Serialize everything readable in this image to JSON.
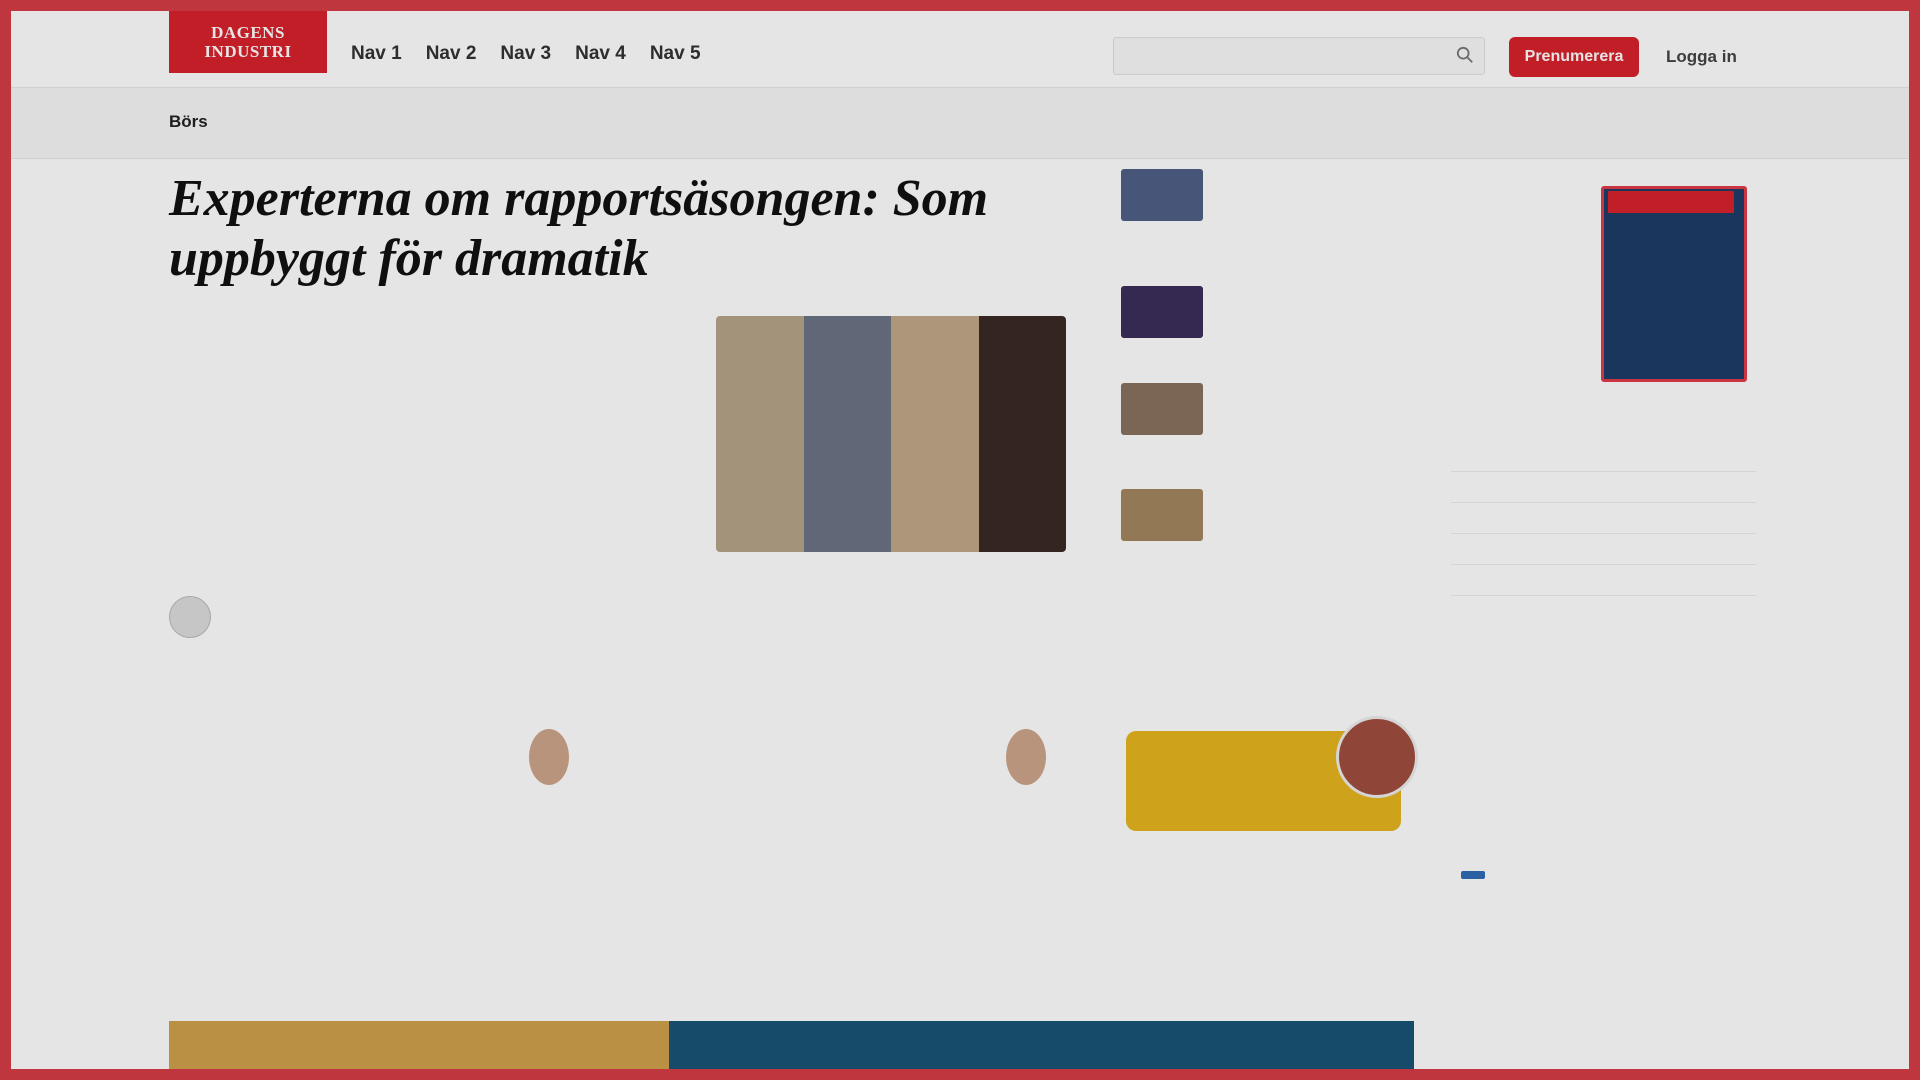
{
  "header": {
    "logo": "DAGENS INDUSTRI",
    "nav": [
      "Nav 1",
      "Nav 2",
      "Nav 3",
      "Nav 4",
      "Nav 5"
    ],
    "search_placeholder": "",
    "cta": "Prenumerera",
    "login": "Logga in"
  },
  "ticker": {
    "label": "Börs",
    "items": [
      {
        "name": "",
        "change": ""
      },
      {
        "name": "",
        "change": ""
      },
      {
        "name": "",
        "change": ""
      },
      {
        "name": "",
        "change": ""
      },
      {
        "name": "",
        "change": ""
      },
      {
        "name": "",
        "change": ""
      },
      {
        "name": "",
        "change": ""
      },
      {
        "name": "",
        "change": ""
      },
      {
        "name": "",
        "change": ""
      }
    ]
  },
  "hero": {
    "title": "Experterna om rapportsäsongen: Som uppbyggt för dramatik",
    "tag": "",
    "lead": "",
    "meta_line": "",
    "meta_line2": "",
    "author": ""
  },
  "side_articles": [
    {
      "tag": "",
      "title": ""
    },
    {
      "tag": "",
      "title": ""
    },
    {
      "tag": "",
      "title": ""
    },
    {
      "tag": "",
      "title": ""
    }
  ],
  "cards": [
    {
      "tag": "",
      "time": "",
      "title": "",
      "lead": ""
    },
    {
      "tag": "",
      "time": "",
      "title": "",
      "lead": ""
    }
  ],
  "quote": {
    "label": "",
    "text": ""
  },
  "right": {
    "mag_text": "",
    "heading": "",
    "list": [
      {
        "time": "",
        "title": ""
      },
      {
        "time": "",
        "title": ""
      },
      {
        "time": "",
        "title": ""
      },
      {
        "time": "",
        "title": ""
      },
      {
        "time": "",
        "title": ""
      }
    ],
    "pill": "",
    "news": {
      "time": "",
      "title": ""
    }
  },
  "banner": {
    "title": ""
  }
}
